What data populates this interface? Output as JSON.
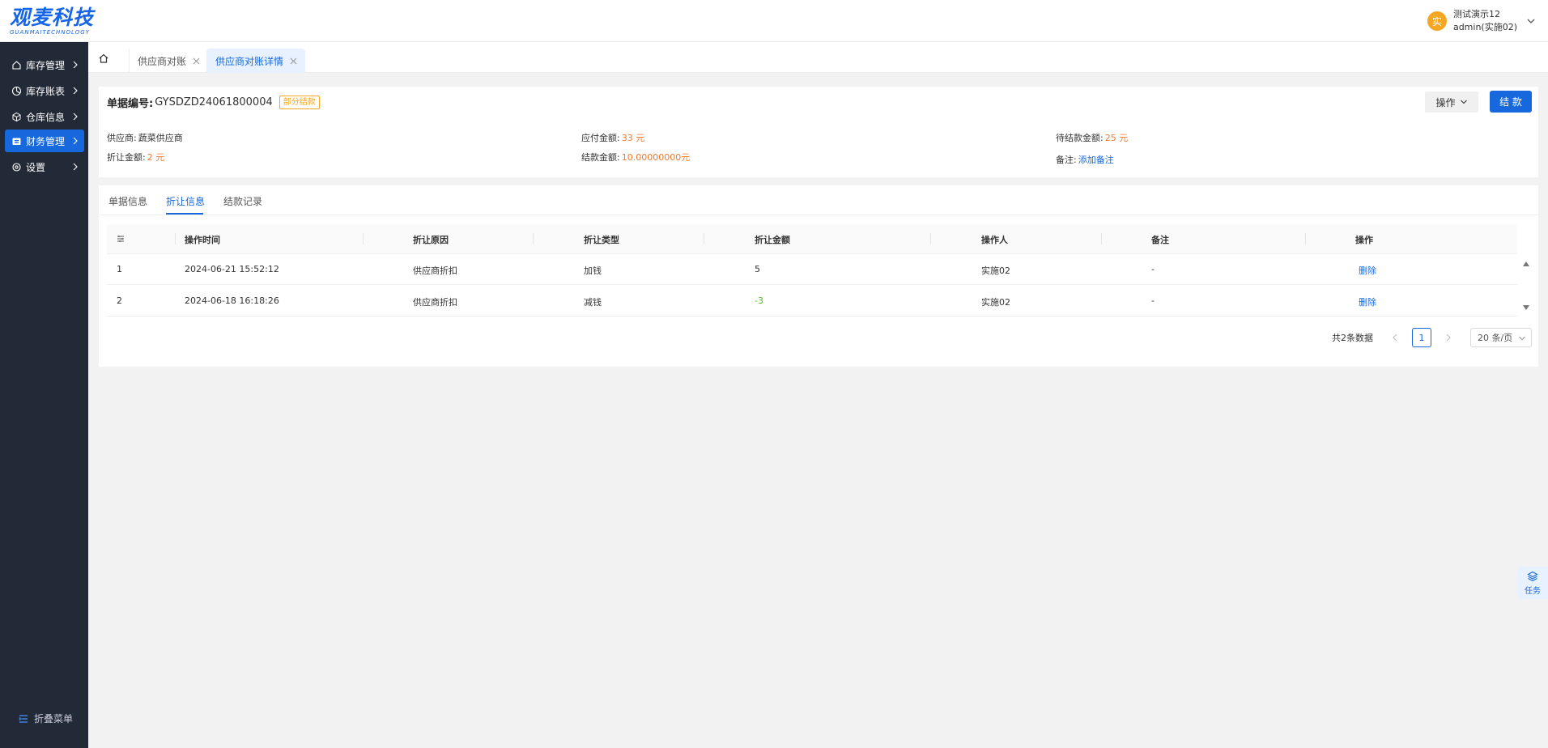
{
  "header": {
    "logo_main": "观麦科技",
    "logo_sub": "GUANMAITECHNOLOGY",
    "avatar_char": "实",
    "user_company": "测试演示12",
    "user_account": "admin(实施02)"
  },
  "sidebar": {
    "items": [
      {
        "label": "库存管理",
        "icon": "home-icon"
      },
      {
        "label": "库存账表",
        "icon": "chart-icon"
      },
      {
        "label": "仓库信息",
        "icon": "box-icon"
      },
      {
        "label": "财务管理",
        "icon": "wallet-icon"
      },
      {
        "label": "设置",
        "icon": "gear-icon"
      }
    ],
    "active_index": 3,
    "collapse_label": "折叠菜单"
  },
  "tabs": {
    "items": [
      {
        "label": "供应商对账",
        "active": false
      },
      {
        "label": "供应商对账详情",
        "active": true
      }
    ]
  },
  "doc": {
    "number_label": "单据编号:",
    "number_value": "GYSDZD24061800004",
    "status_badge": "部分结款",
    "op_button": "操作",
    "settle_button": "结 款",
    "fields": {
      "supplier_label": "供应商:",
      "supplier_value": "蔬菜供应商",
      "discount_label": "折让金额:",
      "discount_value": "2 元",
      "payable_label": "应付金额:",
      "payable_value": "33 元",
      "settled_label": "结款金额:",
      "settled_value": "10.00000000元",
      "pending_label": "待结款金额:",
      "pending_value": "25 元",
      "remark_label": "备注:",
      "remark_link": "添加备注"
    }
  },
  "subtabs": {
    "items": [
      "单据信息",
      "折让信息",
      "结款记录"
    ],
    "active_index": 1
  },
  "table": {
    "columns": [
      "操作时间",
      "折让原因",
      "折让类型",
      "折让金额",
      "操作人",
      "备注",
      "操作"
    ],
    "rows": [
      {
        "index": "1",
        "time": "2024-06-21 15:52:12",
        "reason": "供应商折扣",
        "type": "加钱",
        "amount": "5",
        "amount_color": "#333333",
        "operator": "实施02",
        "remark": "-",
        "action": "删除"
      },
      {
        "index": "2",
        "time": "2024-06-18 16:18:26",
        "reason": "供应商折扣",
        "type": "减钱",
        "amount": "-3",
        "amount_color": "#52c41a",
        "operator": "实施02",
        "remark": "-",
        "action": "删除"
      }
    ]
  },
  "pagination": {
    "total_text": "共2条数据",
    "current_page": "1",
    "page_size": "20 条/页"
  },
  "task_float": {
    "label": "任务"
  },
  "colors": {
    "primary": "#1668dc",
    "sidebar_bg": "#222a37",
    "accent_orange": "#f07a30",
    "badge_orange": "#f5a623",
    "negative_green": "#52c41a"
  }
}
